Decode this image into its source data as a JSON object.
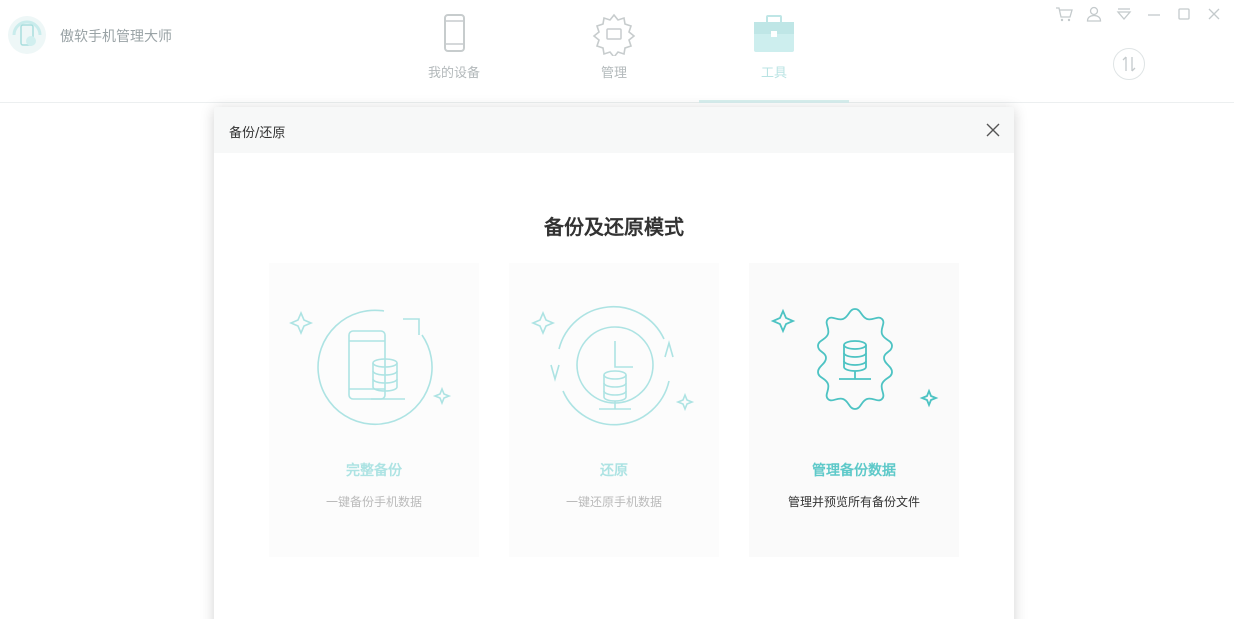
{
  "app": {
    "title": "傲软手机管理大师",
    "nav": [
      {
        "label": "我的设备",
        "icon": "phone-icon",
        "active": false
      },
      {
        "label": "管理",
        "icon": "gear-folder-icon",
        "active": false
      },
      {
        "label": "工具",
        "icon": "toolbox-icon",
        "active": true
      }
    ],
    "top_icons": [
      "cart-icon",
      "user-icon",
      "dropdown-icon",
      "minimize-icon",
      "maximize-icon",
      "close-icon"
    ]
  },
  "modal": {
    "title": "备份/还原",
    "heading": "备份及还原模式",
    "cards": [
      {
        "title": "完整备份",
        "desc": "一键备份手机数据",
        "icon": "phone-backup-icon",
        "state": "disabled"
      },
      {
        "title": "还原",
        "desc": "一键还原手机数据",
        "icon": "restore-clock-icon",
        "state": "disabled"
      },
      {
        "title": "管理备份数据",
        "desc": "管理并预览所有备份文件",
        "icon": "gear-database-icon",
        "state": "selected"
      }
    ]
  },
  "colors": {
    "accent": "#5ec9c9",
    "accent_light": "#b9e3e3",
    "muted": "#b3b9bb"
  }
}
